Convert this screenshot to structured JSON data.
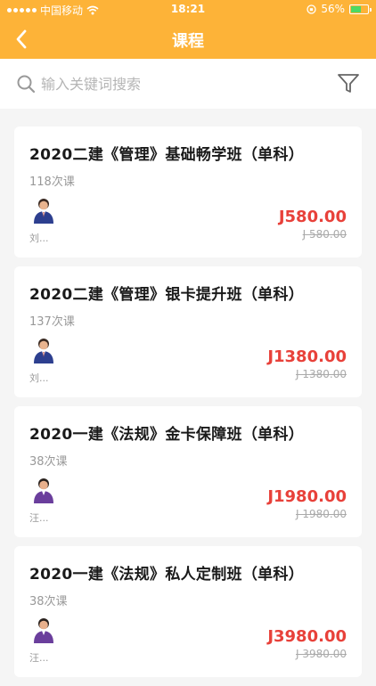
{
  "status_bar": {
    "carrier": "中国移动",
    "time": "18:21",
    "battery": "56%"
  },
  "nav": {
    "title": "课程"
  },
  "search": {
    "placeholder": "输入关键词搜索"
  },
  "courses": [
    {
      "title": "2020二建《管理》基础畅学班（单科）",
      "lessons": "118次课",
      "teacher": "刘...",
      "price": "J580.00",
      "original_price": "J 580.00"
    },
    {
      "title": "2020二建《管理》银卡提升班（单科）",
      "lessons": "137次课",
      "teacher": "刘...",
      "price": "J1380.00",
      "original_price": "J 1380.00"
    },
    {
      "title": "2020一建《法规》金卡保障班（单科）",
      "lessons": "38次课",
      "teacher": "汪...",
      "price": "J1980.00",
      "original_price": "J 1980.00"
    },
    {
      "title": "2020一建《法规》私人定制班（单科）",
      "lessons": "38次课",
      "teacher": "汪...",
      "price": "J3980.00",
      "original_price": "J 3980.00"
    }
  ],
  "colors": {
    "header": "#fdb338",
    "price": "#e8413a"
  }
}
